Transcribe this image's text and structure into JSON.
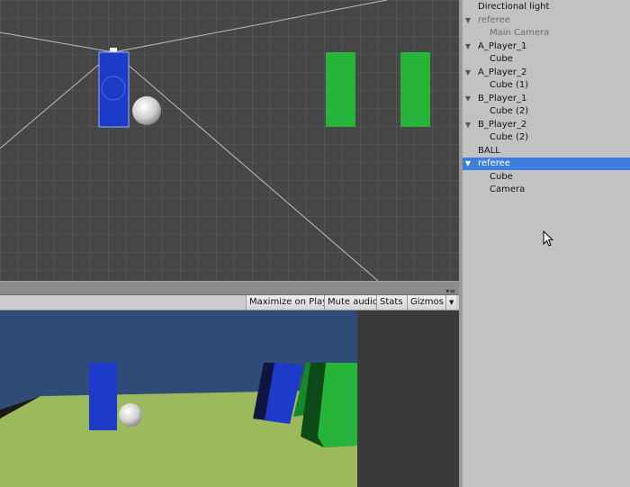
{
  "hierarchy": {
    "items": [
      {
        "label": "Directional light",
        "depth": 0,
        "foldout": false,
        "state": "normal"
      },
      {
        "label": "referee",
        "depth": 0,
        "foldout": true,
        "state": "inactive"
      },
      {
        "label": "Main Camera",
        "depth": 1,
        "foldout": false,
        "state": "inactive"
      },
      {
        "label": "A_Player_1",
        "depth": 0,
        "foldout": true,
        "state": "normal"
      },
      {
        "label": "Cube",
        "depth": 1,
        "foldout": false,
        "state": "normal"
      },
      {
        "label": "A_Player_2",
        "depth": 0,
        "foldout": true,
        "state": "normal"
      },
      {
        "label": "Cube (1)",
        "depth": 1,
        "foldout": false,
        "state": "normal"
      },
      {
        "label": "B_Player_1",
        "depth": 0,
        "foldout": true,
        "state": "normal"
      },
      {
        "label": "Cube (2)",
        "depth": 1,
        "foldout": false,
        "state": "normal"
      },
      {
        "label": "B_Player_2",
        "depth": 0,
        "foldout": true,
        "state": "normal"
      },
      {
        "label": "Cube (2)",
        "depth": 1,
        "foldout": false,
        "state": "normal"
      },
      {
        "label": "BALL",
        "depth": 0,
        "foldout": false,
        "state": "normal"
      },
      {
        "label": "referee",
        "depth": 0,
        "foldout": true,
        "state": "selected"
      },
      {
        "label": "Cube",
        "depth": 1,
        "foldout": false,
        "state": "normal"
      },
      {
        "label": "Camera",
        "depth": 1,
        "foldout": false,
        "state": "normal"
      }
    ]
  },
  "game_toolbar": {
    "maximize_label": "Maximize on Play",
    "mute_label": "Mute audio",
    "stats_label": "Stats",
    "gizmos_label": "Gizmos",
    "gizmos_dropdown_icon": "triangle-down-icon"
  },
  "colors": {
    "selection": "#3e7de0",
    "player_blue": "#1c3bc9",
    "player_green": "#26b43a",
    "sky": "#2f4b78",
    "ground": "#9cb95b"
  },
  "icons": {
    "splitter_grip": "panel-menu-icon",
    "cursor": "mouse-pointer-icon"
  }
}
